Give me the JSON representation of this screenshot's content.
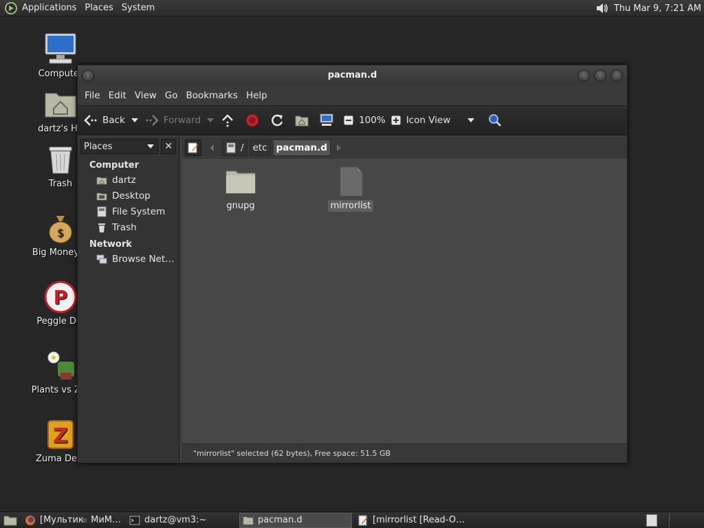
{
  "top_panel": {
    "menus": [
      "Applications",
      "Places",
      "System"
    ],
    "clock": "Thu Mar  9,  7:21 AM",
    "icons": {
      "logo": "distro-logo-icon",
      "volume": "volume-icon"
    }
  },
  "desktop_icons": [
    {
      "label": "Computer",
      "icon": "computer-icon"
    },
    {
      "label": "dartz's Ho",
      "icon": "home-folder-icon"
    },
    {
      "label": "Trash",
      "icon": "trash-icon"
    },
    {
      "label": "Big Money D",
      "icon": "money-bag-icon"
    },
    {
      "label": "Peggle Del",
      "icon": "peggle-icon"
    },
    {
      "label": "Plants vs Zor",
      "icon": "plants-icon"
    },
    {
      "label": "Zuma Delu",
      "icon": "zuma-icon"
    }
  ],
  "window": {
    "title": "pacman.d",
    "menu": [
      "File",
      "Edit",
      "View",
      "Go",
      "Bookmarks",
      "Help"
    ],
    "toolbar": {
      "back": "Back",
      "forward": "Forward",
      "zoom": "100%",
      "view_mode": "Icon View"
    },
    "sidebar": {
      "selector": "Places",
      "close": "✕",
      "groups": [
        {
          "title": "Computer",
          "items": [
            {
              "label": "dartz",
              "icon": "home-icon"
            },
            {
              "label": "Desktop",
              "icon": "desktop-icon"
            },
            {
              "label": "File System",
              "icon": "filesystem-icon"
            },
            {
              "label": "Trash",
              "icon": "trash-icon"
            }
          ]
        },
        {
          "title": "Network",
          "items": [
            {
              "label": "Browse Net…",
              "icon": "network-icon"
            }
          ]
        }
      ]
    },
    "pathbar": {
      "root": "/",
      "crumbs": [
        "etc",
        "pacman.d"
      ]
    },
    "files": [
      {
        "name": "gnupg",
        "type": "folder",
        "selected": false
      },
      {
        "name": "mirrorlist",
        "type": "file",
        "selected": true
      }
    ],
    "status": "\"mirrorlist\" selected (62 bytes), Free space: 51.5 GB"
  },
  "taskbar": {
    "tasks": [
      {
        "label": "[Мультик",
        "icon": "firefox-icon",
        "active": false
      },
      {
        "label": "МиМ…",
        "icon": "app-icon",
        "active": false
      },
      {
        "label": "dartz@vm3:~",
        "icon": "terminal-icon",
        "active": false
      },
      {
        "label": "pacman.d",
        "icon": "folder-icon",
        "active": true
      },
      {
        "label": "[mirrorlist [Read-O…",
        "icon": "text-editor-icon",
        "active": false
      }
    ]
  },
  "colors": {
    "desktop_bg": "#262626",
    "window_bg": "#3d3d3d",
    "icon_view_bg": "#474747",
    "stop_red": "#c0272d"
  }
}
